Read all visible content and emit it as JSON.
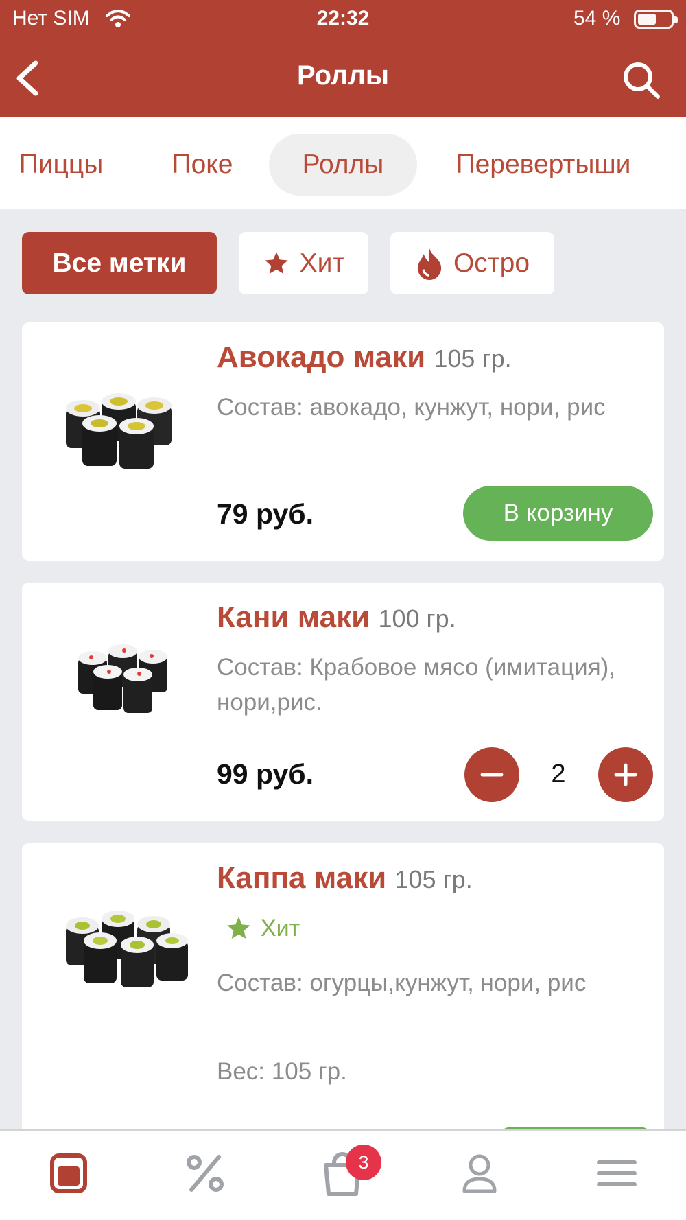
{
  "status": {
    "carrier": "Нет SIM",
    "time": "22:32",
    "battery": "54 %"
  },
  "header": {
    "title": "Роллы"
  },
  "categories": [
    "Пиццы",
    "Поке",
    "Роллы",
    "Перевертыши"
  ],
  "filters": {
    "all": "Все метки",
    "hit": "Хит",
    "spicy": "Остро"
  },
  "products": [
    {
      "name": "Авокадо маки",
      "weight": "105 гр.",
      "desc": "Состав: авокадо, кунжут, нори, рис",
      "price": "79 руб.",
      "button": "В корзину"
    },
    {
      "name": "Кани маки",
      "weight": "100 гр.",
      "desc": "Состав: Крабовое мясо (имитация), нори,рис.",
      "price": "99 руб.",
      "qty": "2"
    },
    {
      "name": "Каппа маки",
      "weight": "105 гр.",
      "tag": "Хит",
      "desc": "Состав: огурцы,кунжут, нори, рис",
      "weight_line": "Вес: 105 гр."
    }
  ],
  "tabbar": {
    "cart_count": "3"
  },
  "colors": {
    "brand": "#b14132",
    "accent_green": "#66b257",
    "hit_green": "#7fb04a",
    "badge": "#e5334a"
  }
}
